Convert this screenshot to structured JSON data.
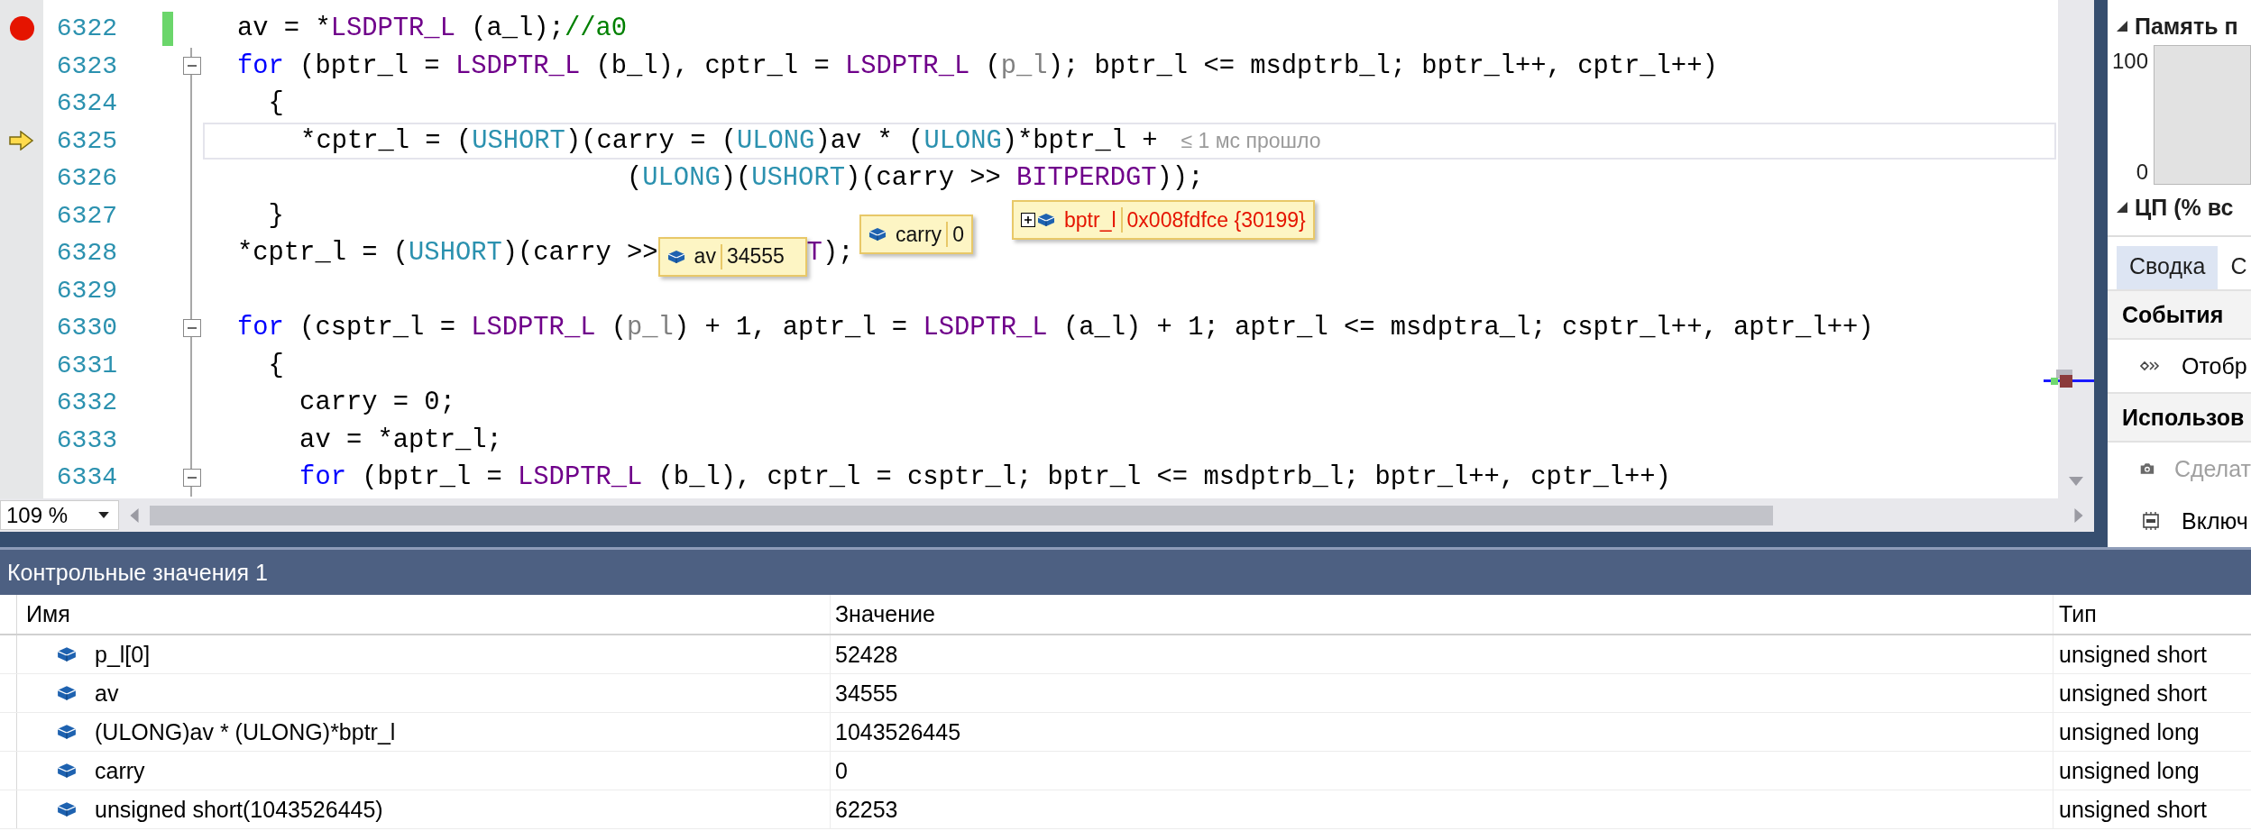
{
  "editor": {
    "lines": [
      {
        "number": "6322",
        "breakpoint": true,
        "current": false,
        "changed": true,
        "foldable": false,
        "segments": [
          {
            "kind": "plain",
            "text": "av = *"
          },
          {
            "kind": "macro",
            "text": "LSDPTR_L"
          },
          {
            "kind": "plain",
            "text": " (a_l);"
          },
          {
            "kind": "comment",
            "text": "//a0"
          }
        ]
      },
      {
        "number": "6323",
        "breakpoint": false,
        "current": false,
        "changed": false,
        "foldable": true,
        "segments": [
          {
            "kind": "keyword",
            "text": "for"
          },
          {
            "kind": "plain",
            "text": " (bptr_l = "
          },
          {
            "kind": "macro",
            "text": "LSDPTR_L"
          },
          {
            "kind": "plain",
            "text": " (b_l), cptr_l = "
          },
          {
            "kind": "macro",
            "text": "LSDPTR_L"
          },
          {
            "kind": "plain",
            "text": " ("
          },
          {
            "kind": "param",
            "text": "p_l"
          },
          {
            "kind": "plain",
            "text": "); bptr_l <= msdptrb_l; bptr_l++, cptr_l++)"
          }
        ]
      },
      {
        "number": "6324",
        "breakpoint": false,
        "current": false,
        "changed": false,
        "foldable": false,
        "segments": [
          {
            "kind": "plain",
            "text": "  {"
          }
        ]
      },
      {
        "number": "6325",
        "breakpoint": false,
        "current": true,
        "changed": false,
        "foldable": false,
        "hint": "≤ 1 мс прошло",
        "segments": [
          {
            "kind": "plain",
            "text": "    *cptr_l = ("
          },
          {
            "kind": "type",
            "text": "USHORT"
          },
          {
            "kind": "plain",
            "text": ")(carry = ("
          },
          {
            "kind": "type",
            "text": "ULONG"
          },
          {
            "kind": "plain",
            "text": ")av * ("
          },
          {
            "kind": "type",
            "text": "ULONG"
          },
          {
            "kind": "plain",
            "text": ")*bptr_l +"
          }
        ]
      },
      {
        "number": "6326",
        "breakpoint": false,
        "current": false,
        "changed": false,
        "foldable": false,
        "segments": [
          {
            "kind": "plain",
            "text": "                         ("
          },
          {
            "kind": "type",
            "text": "ULONG"
          },
          {
            "kind": "plain",
            "text": ")("
          },
          {
            "kind": "type",
            "text": "USHORT"
          },
          {
            "kind": "plain",
            "text": ")(carry >> "
          },
          {
            "kind": "macro",
            "text": "BITPERDGT"
          },
          {
            "kind": "plain",
            "text": "));"
          }
        ]
      },
      {
        "number": "6327",
        "breakpoint": false,
        "current": false,
        "changed": false,
        "foldable": false,
        "segments": [
          {
            "kind": "plain",
            "text": "  }"
          }
        ]
      },
      {
        "number": "6328",
        "breakpoint": false,
        "current": false,
        "changed": false,
        "foldable": false,
        "segments": [
          {
            "kind": "plain",
            "text": "*cptr_l = ("
          },
          {
            "kind": "type",
            "text": "USHORT"
          },
          {
            "kind": "plain",
            "text": ")(carry >>"
          },
          {
            "kind": "datatip",
            "name": "av",
            "value": "34555",
            "changed": false,
            "expandable": false
          },
          {
            "kind": "macro",
            "text": "T"
          },
          {
            "kind": "plain",
            "text": ");"
          }
        ]
      },
      {
        "number": "6329",
        "breakpoint": false,
        "current": false,
        "changed": false,
        "foldable": false
      },
      {
        "number": "6330",
        "breakpoint": false,
        "current": false,
        "changed": false,
        "foldable": true,
        "segments": [
          {
            "kind": "keyword",
            "text": "for"
          },
          {
            "kind": "plain",
            "text": " (csptr_l = "
          },
          {
            "kind": "macro",
            "text": "LSDPTR_L"
          },
          {
            "kind": "plain",
            "text": " ("
          },
          {
            "kind": "param",
            "text": "p_l"
          },
          {
            "kind": "plain",
            "text": ") + 1, aptr_l = "
          },
          {
            "kind": "macro",
            "text": "LSDPTR_L"
          },
          {
            "kind": "plain",
            "text": " (a_l) + 1; aptr_l <= msdptra_l; csptr_l++, aptr_l++)"
          }
        ]
      },
      {
        "number": "6331",
        "breakpoint": false,
        "current": false,
        "changed": false,
        "foldable": false,
        "segments": [
          {
            "kind": "plain",
            "text": "  {"
          }
        ]
      },
      {
        "number": "6332",
        "breakpoint": false,
        "current": false,
        "changed": false,
        "foldable": false,
        "segments": [
          {
            "kind": "plain",
            "text": "    carry = 0;"
          }
        ]
      },
      {
        "number": "6333",
        "breakpoint": false,
        "current": false,
        "changed": false,
        "foldable": false,
        "segments": [
          {
            "kind": "plain",
            "text": "    av = *aptr_l;"
          }
        ]
      },
      {
        "number": "6334",
        "breakpoint": false,
        "current": false,
        "changed": false,
        "foldable": true,
        "segments": [
          {
            "kind": "keyword",
            "text": "    for"
          },
          {
            "kind": "plain",
            "text": " (bptr_l = "
          },
          {
            "kind": "macro",
            "text": "LSDPTR_L"
          },
          {
            "kind": "plain",
            "text": " (b_l), cptr_l = csptr_l; bptr_l <= msdptrb_l; bptr_l++, cptr_l++)"
          }
        ]
      }
    ],
    "datatips": [
      {
        "name": "carry",
        "value": "0",
        "changed": false,
        "expandable": false
      },
      {
        "name": "bptr_l",
        "value": "0x008fdfce {30199}",
        "changed": true,
        "expandable": true
      }
    ],
    "zoom": "109 %"
  },
  "diagnostics": {
    "sections": [
      {
        "title": "Память п",
        "expanded": true
      },
      {
        "title": "ЦП (% вс",
        "expanded": true
      }
    ],
    "memory_axis": {
      "max": "100",
      "min": "0"
    },
    "tabs": [
      {
        "label": "Сводка",
        "selected": true
      },
      {
        "label": "С",
        "selected": false
      }
    ],
    "groups": [
      {
        "title": "События",
        "items": [
          {
            "kind": "events",
            "label": "Отобр",
            "disabled": false
          }
        ]
      },
      {
        "title": "Использов",
        "items": [
          {
            "kind": "snapshot",
            "label": "Сделат",
            "disabled": true
          },
          {
            "kind": "profiling",
            "label": "Включ",
            "disabled": false
          }
        ]
      }
    ]
  },
  "watch": {
    "title": "Контрольные значения 1",
    "columns": [
      "Имя",
      "Значение",
      "Тип"
    ],
    "rows": [
      {
        "name": "p_l[0]",
        "value": "52428",
        "type": "unsigned short"
      },
      {
        "name": "av",
        "value": "34555",
        "type": "unsigned short"
      },
      {
        "name": "(ULONG)av * (ULONG)*bptr_l",
        "value": "1043526445",
        "type": "unsigned long"
      },
      {
        "name": "carry",
        "value": "0",
        "type": "unsigned long"
      },
      {
        "name": "unsigned short(1043526445)",
        "value": "62253",
        "type": "unsigned short"
      }
    ]
  }
}
